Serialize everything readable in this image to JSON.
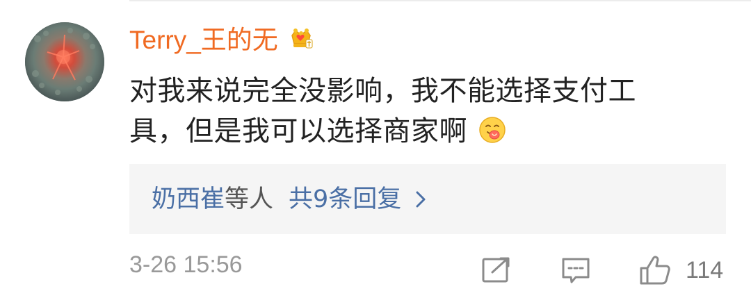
{
  "comment": {
    "username": "Terry_王的无",
    "badge_icon": "crown-badge-icon",
    "text_line1": "对我来说完全没影响，我不能选择支付工",
    "text_line2": "具，但是我可以选择商家啊",
    "inline_emoji": "yum-face-emoji-icon",
    "timestamp": "3-26 15:56"
  },
  "replies": {
    "users": "奶西崔",
    "users_suffix": "等人",
    "count_label": "共9条回复"
  },
  "actions": {
    "share_icon": "edit-share-icon",
    "comment_icon": "comment-icon",
    "like_icon": "thumbs-up-icon",
    "like_count": "114"
  },
  "colors": {
    "username": "#f06a22",
    "link": "#4a6fa5",
    "text": "#222222",
    "meta": "#999999",
    "reply_bg": "#f5f5f5"
  }
}
